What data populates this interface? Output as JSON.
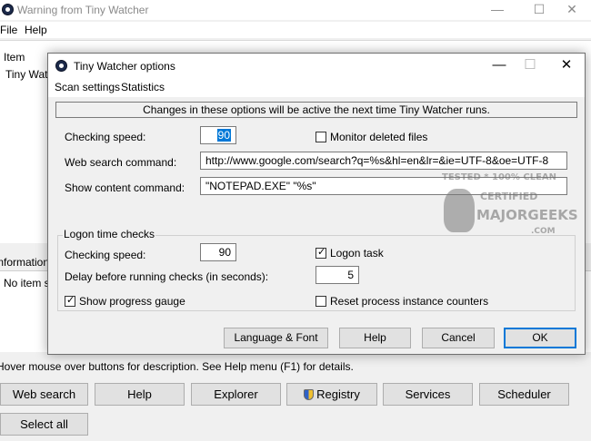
{
  "main_window": {
    "title": "Warning from Tiny Watcher",
    "menu": [
      "File",
      "Help"
    ],
    "columns": [
      "Item"
    ],
    "first_row": "Tiny Watch",
    "info_header": "Information",
    "info_text": "No item s",
    "status_text": "Hover mouse over buttons for description. See Help menu (F1) for details.",
    "buttons": {
      "web_search": "Web search",
      "help": "Help",
      "explorer": "Explorer",
      "registry": "Registry",
      "services": "Services",
      "scheduler": "Scheduler",
      "select_all": "Select all"
    }
  },
  "dialog": {
    "title": "Tiny Watcher options",
    "menu": [
      "Scan settings",
      "Statistics"
    ],
    "notice": "Changes in these options will be active the next time Tiny Watcher runs.",
    "checking_speed_label": "Checking speed:",
    "checking_speed_value": "90",
    "monitor_deleted_label": "Monitor deleted files",
    "monitor_deleted_checked": false,
    "web_search_label": "Web search command:",
    "web_search_value": "http://www.google.com/search?q=%s&hl=en&lr=&ie=UTF-8&oe=UTF-8",
    "show_content_label": "Show content command:",
    "show_content_value": "\"NOTEPAD.EXE\" \"%s\"",
    "logon_group_title": "Logon time checks",
    "logon_speed_label": "Checking speed:",
    "logon_speed_value": "90",
    "logon_task_label": "Logon task",
    "logon_task_checked": true,
    "delay_label": "Delay before running checks (in seconds):",
    "delay_value": "5",
    "progress_label": "Show progress gauge",
    "progress_checked": true,
    "reset_label": "Reset process instance counters",
    "reset_checked": false,
    "buttons": {
      "language_font": "Language & Font",
      "help": "Help",
      "cancel": "Cancel",
      "ok": "OK"
    }
  },
  "watermark": {
    "line1": "TESTED * 100% CLEAN",
    "line2": "CERTIFIED",
    "line3": "MAJORGEEKS",
    "line4": ".COM"
  },
  "colors": {
    "selection": "#0078d7",
    "button_face": "#e1e1e1",
    "dialog_face": "#f0f0f0"
  }
}
